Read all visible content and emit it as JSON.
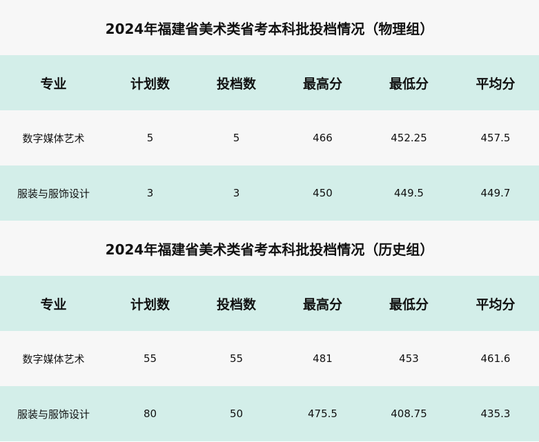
{
  "colors": {
    "header_background": "#d3eee9",
    "title_background": "#f7f7f7",
    "odd_row_background": "#f7f7f7",
    "even_row_background": "#d3eee9"
  },
  "tables": [
    {
      "title": "2024年福建省美术类省考本科批投档情况（物理组）",
      "headers": [
        "专业",
        "计划数",
        "投档数",
        "最高分",
        "最低分",
        "平均分"
      ],
      "rows": [
        [
          "数字媒体艺术",
          "5",
          "5",
          "466",
          "452.25",
          "457.5"
        ],
        [
          "服装与服饰设计",
          "3",
          "3",
          "450",
          "449.5",
          "449.7"
        ]
      ]
    },
    {
      "title": "2024年福建省美术类省考本科批投档情况（历史组）",
      "headers": [
        "专业",
        "计划数",
        "投档数",
        "最高分",
        "最低分",
        "平均分"
      ],
      "rows": [
        [
          "数字媒体艺术",
          "55",
          "55",
          "481",
          "453",
          "461.6"
        ],
        [
          "服装与服饰设计",
          "80",
          "50",
          "475.5",
          "408.75",
          "435.3"
        ]
      ]
    }
  ]
}
